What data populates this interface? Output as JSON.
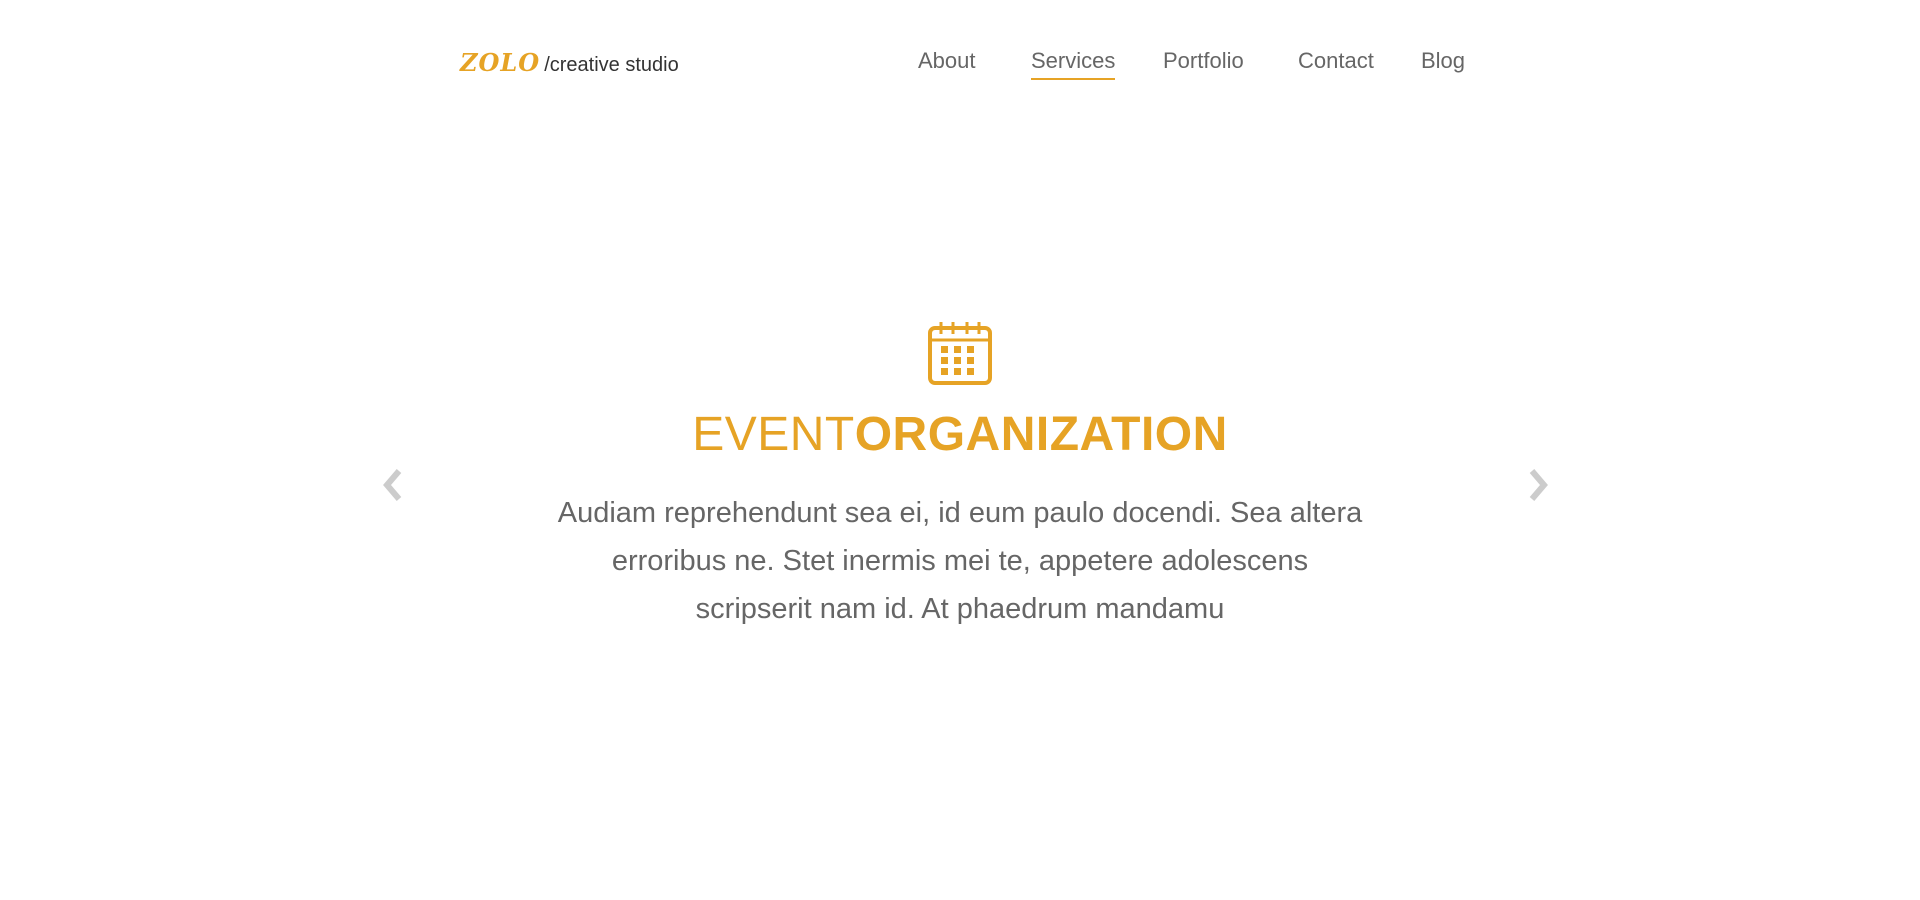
{
  "brand": {
    "logo_text": "ZOLO",
    "tagline": "/creative studio",
    "accent_color": "#e6a325"
  },
  "nav": {
    "items": [
      {
        "label": "About"
      },
      {
        "label": "Services",
        "active": true
      },
      {
        "label": "Portfolio"
      },
      {
        "label": "Contact"
      },
      {
        "label": "Blog"
      }
    ]
  },
  "slider": {
    "prev_icon": "chevron-left-icon",
    "next_icon": "chevron-right-icon",
    "slide": {
      "icon": "calendar-icon",
      "title_light": "EVENT",
      "title_bold": "ORGANIZATION",
      "description": "Audiam reprehendunt sea ei, id eum paulo docendi. Sea altera erroribus ne. Stet inermis mei te, appetere adolescens scripserit nam id. At phaedrum mandamu"
    }
  }
}
